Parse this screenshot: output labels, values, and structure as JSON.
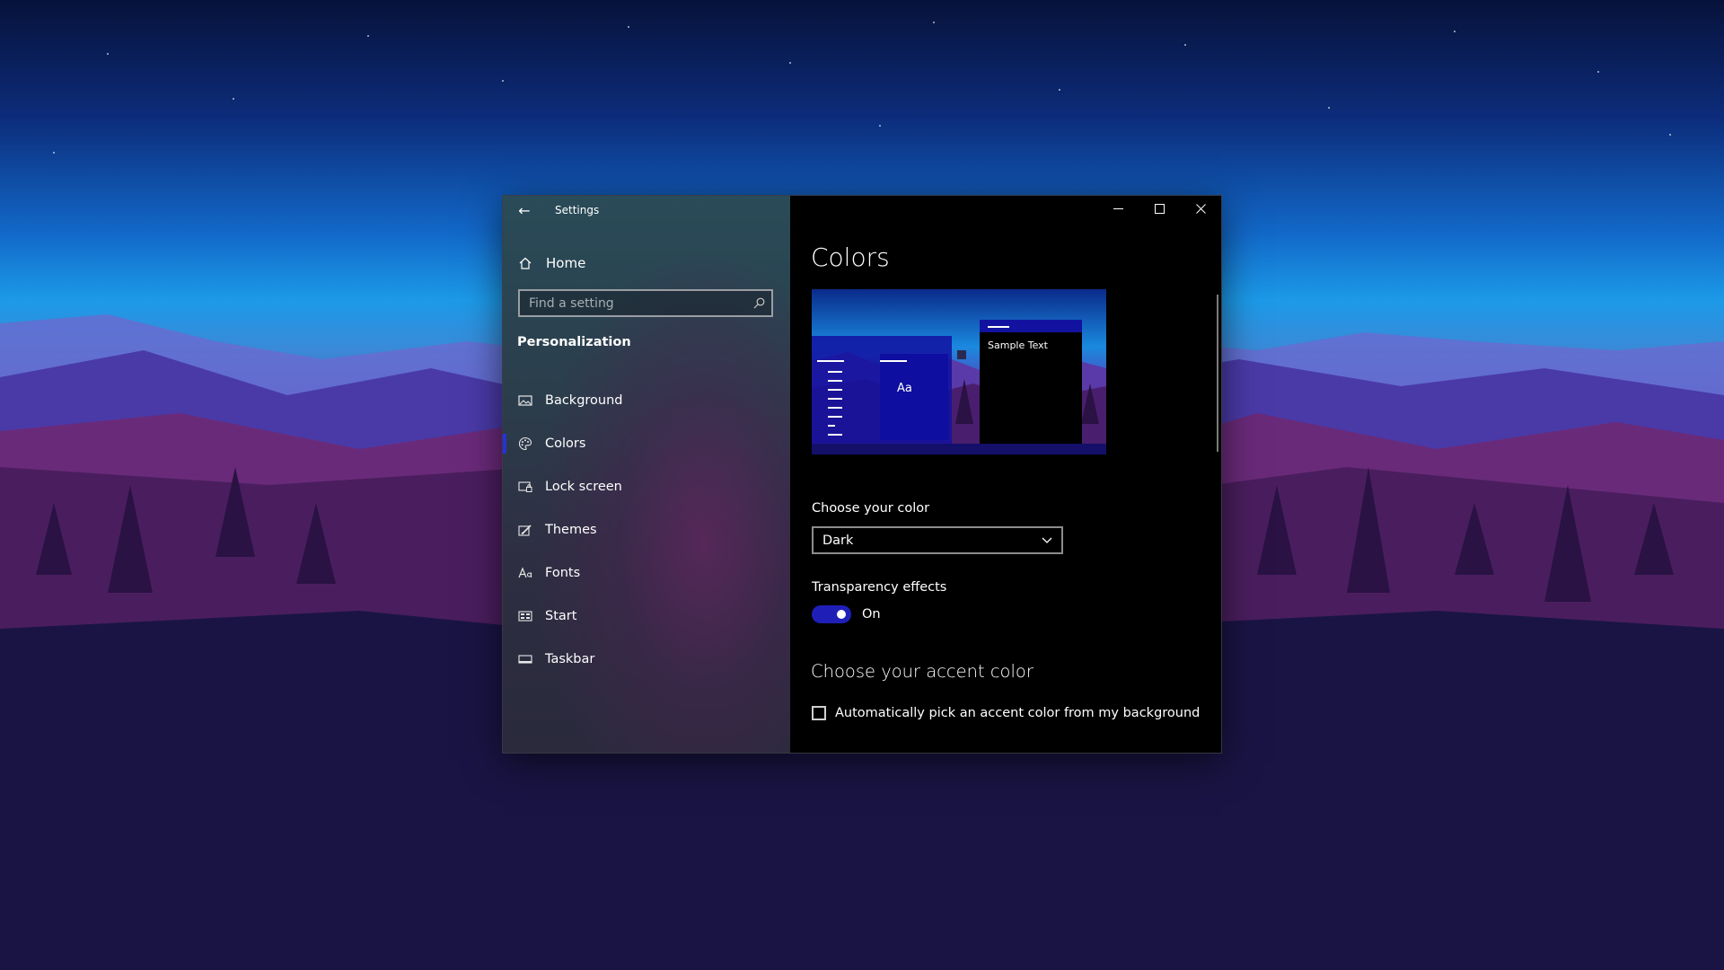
{
  "window": {
    "app_title": "Settings",
    "controls": {
      "minimize": "—",
      "maximize": "☐",
      "close": "✕"
    }
  },
  "nav": {
    "back_label": "←",
    "home_label": "Home",
    "search_placeholder": "Find a setting",
    "section_title": "Personalization",
    "items": [
      {
        "label": "Background",
        "icon": "image-icon"
      },
      {
        "label": "Colors",
        "icon": "palette-icon",
        "selected": true
      },
      {
        "label": "Lock screen",
        "icon": "lock-screen-icon"
      },
      {
        "label": "Themes",
        "icon": "themes-icon"
      },
      {
        "label": "Fonts",
        "icon": "fonts-icon"
      },
      {
        "label": "Start",
        "icon": "start-icon"
      },
      {
        "label": "Taskbar",
        "icon": "taskbar-icon"
      }
    ]
  },
  "content": {
    "page_title": "Colors",
    "preview": {
      "sample_text": "Sample Text",
      "tile_text": "Aa"
    },
    "choose_color_label": "Choose your color",
    "choose_color_value": "Dark",
    "transparency_label": "Transparency effects",
    "transparency_state": "On",
    "accent_heading": "Choose your accent color",
    "auto_accent_label": "Automatically pick an accent color from my background"
  },
  "colors": {
    "accent": "#1f1fb8",
    "content_bg": "#000000"
  }
}
